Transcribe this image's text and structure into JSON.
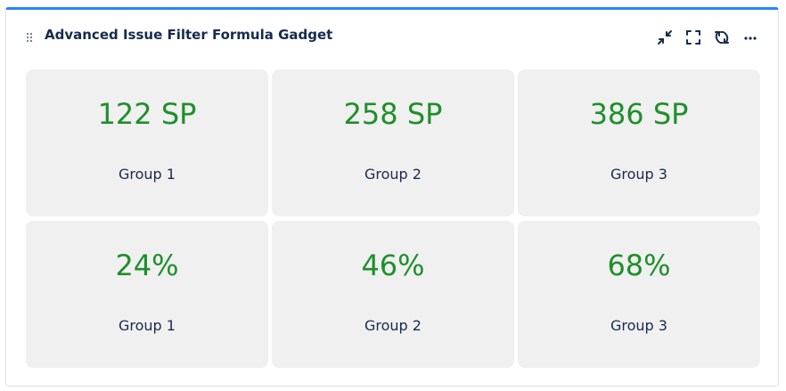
{
  "gadget": {
    "title": "Advanced Issue Filter Formula Gadget",
    "accent_color": "#2684ff",
    "actions": [
      {
        "icon": "minimize-icon"
      },
      {
        "icon": "fullscreen-icon"
      },
      {
        "icon": "refresh-icon"
      },
      {
        "icon": "more-icon"
      }
    ]
  },
  "cards": [
    {
      "value": "122 SP",
      "label": "Group 1"
    },
    {
      "value": "258 SP",
      "label": "Group 2"
    },
    {
      "value": "386 SP",
      "label": "Group 3"
    },
    {
      "value": "24%",
      "label": "Group 1"
    },
    {
      "value": "46%",
      "label": "Group 2"
    },
    {
      "value": "68%",
      "label": "Group 3"
    }
  ],
  "colors": {
    "value_text": "#1f8f2b",
    "card_background": "#f0f0f0",
    "label_text": "#172b4d"
  }
}
